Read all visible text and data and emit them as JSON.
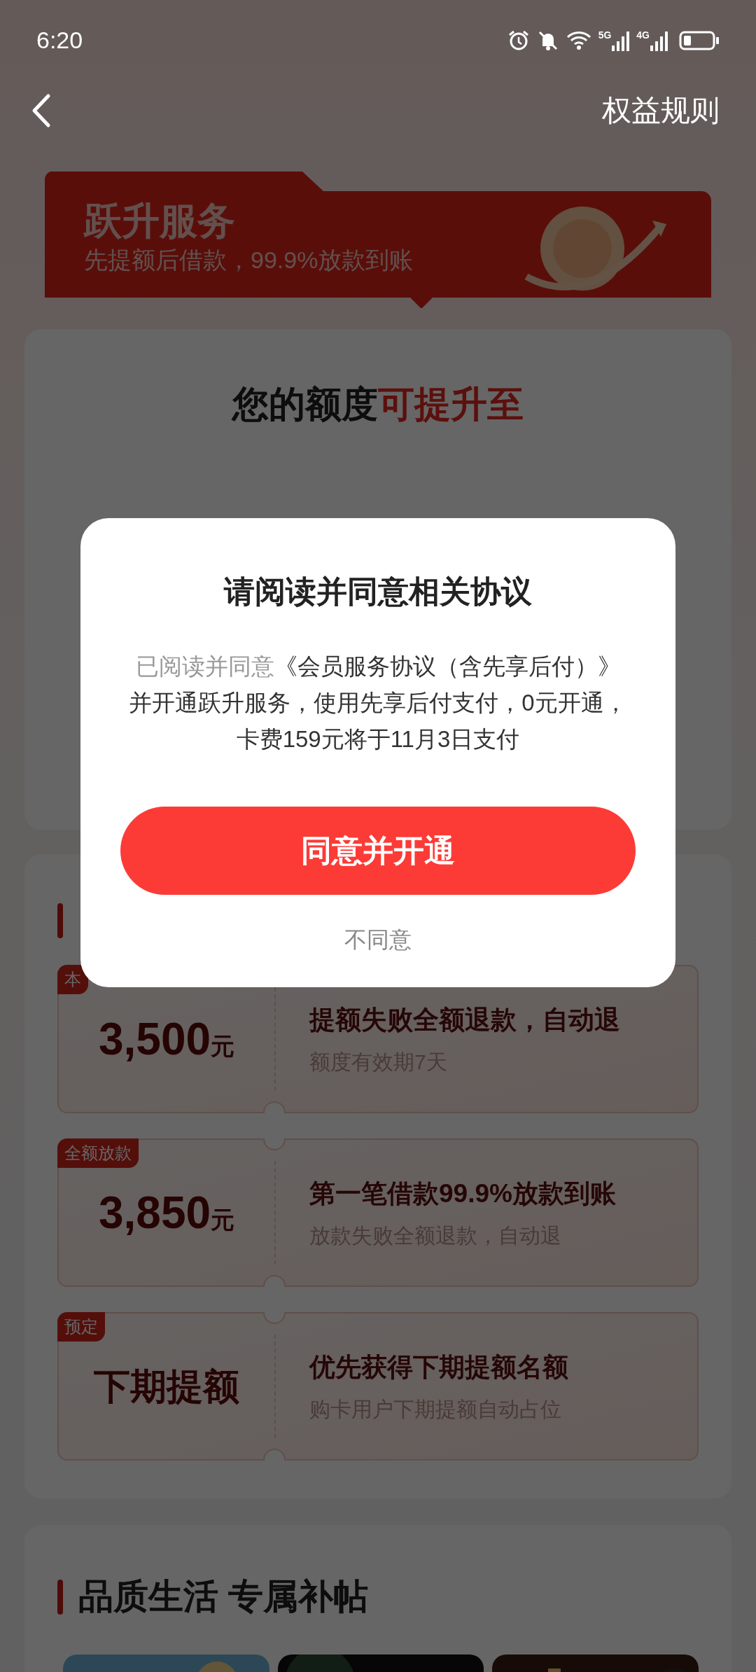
{
  "status_bar": {
    "time": "6:20",
    "network_1": "5G",
    "network_2": "4G"
  },
  "nav": {
    "action": "权益规则"
  },
  "banner": {
    "title": "跃升服务",
    "subtitle": "先提额后借款，99.9%放款到账"
  },
  "quota_card": {
    "title_lead": "您的额度",
    "title_highlight": "可提升至"
  },
  "benefits": {
    "items": [
      {
        "tag": "本",
        "amount": "3,500",
        "unit": "元",
        "title": "提额失败全额退款，自动退",
        "subtitle": "额度有效期7天"
      },
      {
        "tag": "全额放款",
        "amount": "3,850",
        "unit": "元",
        "title": "第一笔借款99.9%放款到账",
        "subtitle": "放款失败全额退款，自动退"
      },
      {
        "tag": "预定",
        "amount": "下期提额",
        "title": "优先获得下期提额名额",
        "subtitle": "购卡用户下期提额自动占位"
      }
    ]
  },
  "perks": {
    "title": "品质生活 专属补帖"
  },
  "dialog": {
    "title": "请阅读并同意相关协议",
    "text_prefix": "已阅读并同意",
    "text": "《会员服务协议（含先享后付）》并开通跃升服务，使用先享后付支付，0元开通，卡费159元将于11月3日支付",
    "confirm": "同意并开通",
    "decline": "不同意"
  }
}
